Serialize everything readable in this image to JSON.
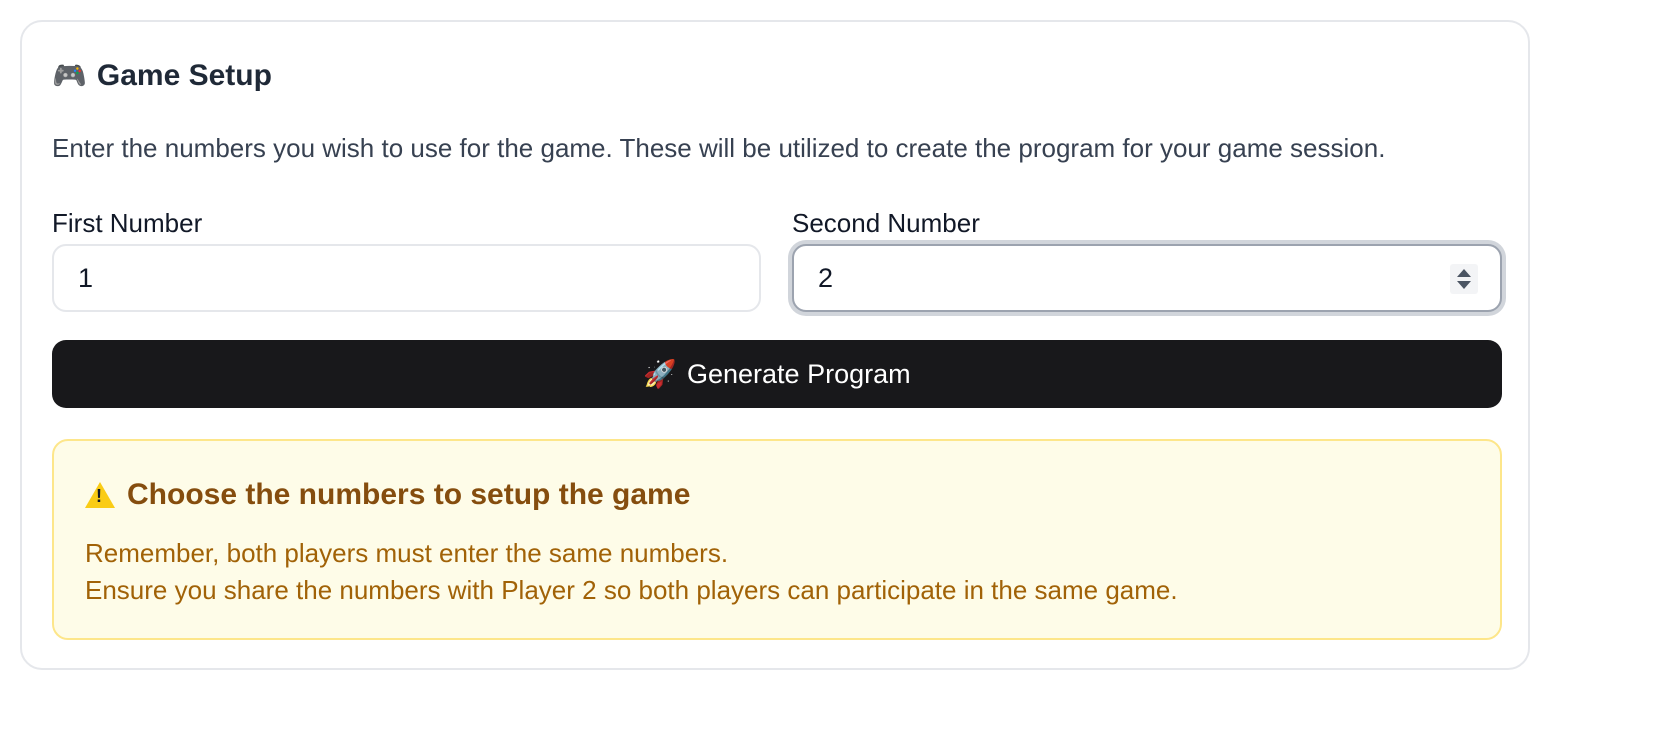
{
  "setup": {
    "title": "Game Setup",
    "title_icon": "gamepad-icon",
    "description": "Enter the numbers you wish to use for the game. These will be utilized to create the program for your game session."
  },
  "fields": {
    "first": {
      "label": "First Number",
      "value": "1"
    },
    "second": {
      "label": "Second Number",
      "value": "2"
    }
  },
  "generate_button": {
    "label": "Generate Program",
    "icon": "rocket-icon"
  },
  "notice": {
    "icon": "warning-icon",
    "title": "Choose the numbers to setup the game",
    "line1": "Remember, both players must enter the same numbers.",
    "line2": "Ensure you share the numbers with Player 2 so both players can participate in the same game."
  },
  "colors": {
    "button_bg": "#18181b",
    "notice_bg": "#fefce8",
    "notice_border": "#fde68a",
    "notice_text": "#a16207"
  }
}
